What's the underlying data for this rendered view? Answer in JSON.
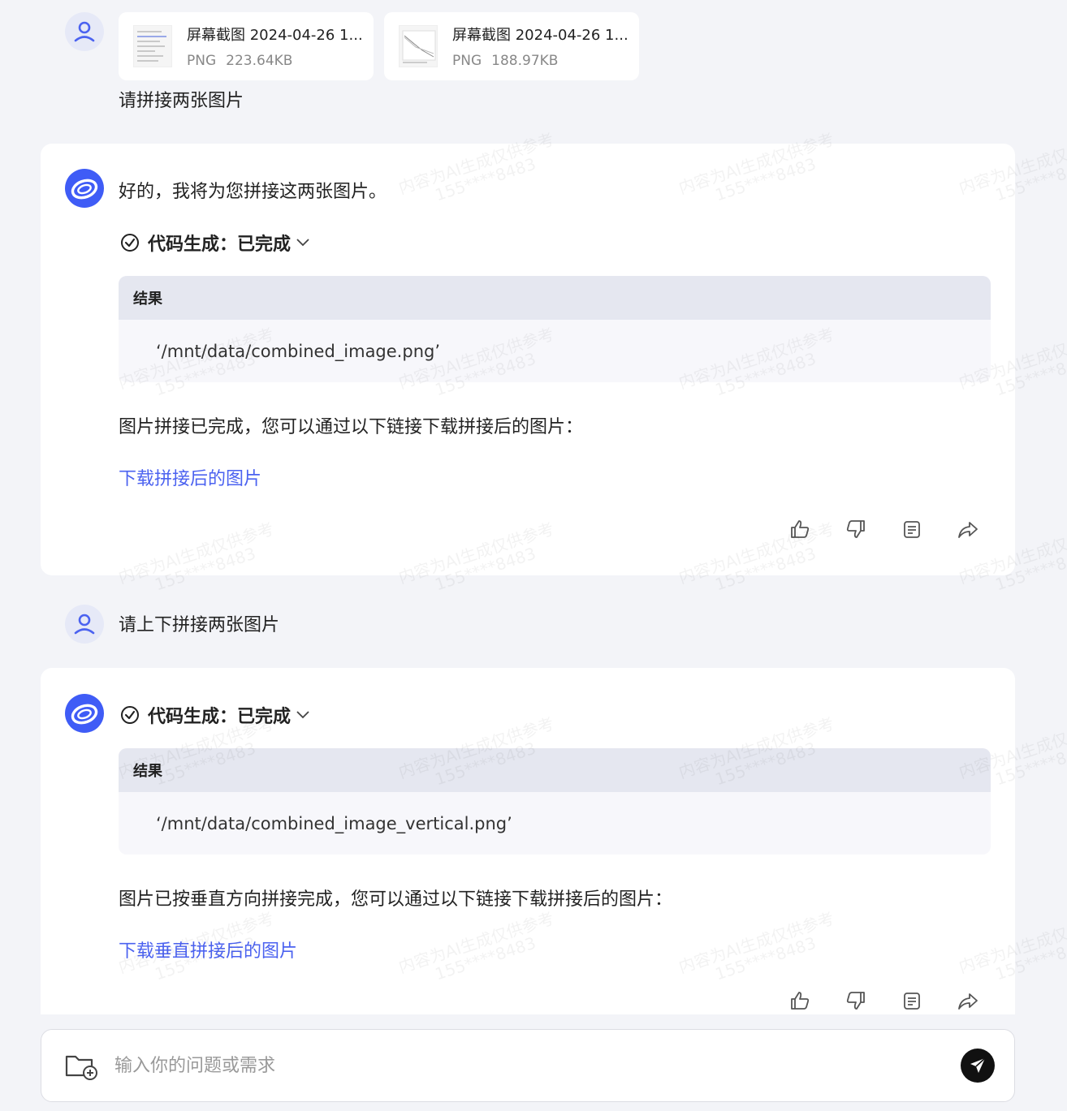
{
  "attachments": [
    {
      "name": "屏幕截图 2024-04-26 1...",
      "type": "PNG",
      "size": "223.64KB"
    },
    {
      "name": "屏幕截图 2024-04-26 1...",
      "type": "PNG",
      "size": "188.97KB"
    }
  ],
  "messages": {
    "user1": "请拼接两张图片",
    "bot1": {
      "intro": "好的，我将为您拼接这两张图片。",
      "code_status": "代码生成：已完成",
      "result_label": "结果",
      "result_value": "‘/mnt/data/combined_image.png’",
      "text": "图片拼接已完成，您可以通过以下链接下载拼接后的图片：",
      "link": "下载拼接后的图片"
    },
    "user2": "请上下拼接两张图片",
    "bot2": {
      "code_status": "代码生成：已完成",
      "result_label": "结果",
      "result_value": "‘/mnt/data/combined_image_vertical.png’",
      "text": "图片已按垂直方向拼接完成，您可以通过以下链接下载拼接后的图片：",
      "link": "下载垂直拼接后的图片"
    }
  },
  "watermark": {
    "line1": "内容为AI生成仅供参考",
    "line2": "155****8483"
  },
  "input": {
    "placeholder": "输入你的问题或需求"
  },
  "icons": {
    "user_avatar": "user-icon",
    "bot_avatar": "bot-logo-icon",
    "actions": [
      "thumbs-up-icon",
      "thumbs-down-icon",
      "copy-icon",
      "share-icon"
    ],
    "attach": "folder-add-icon",
    "send": "send-icon"
  },
  "colors": {
    "accent": "#3f5cf6",
    "link": "#4b62f0",
    "background": "#f3f4f8"
  }
}
